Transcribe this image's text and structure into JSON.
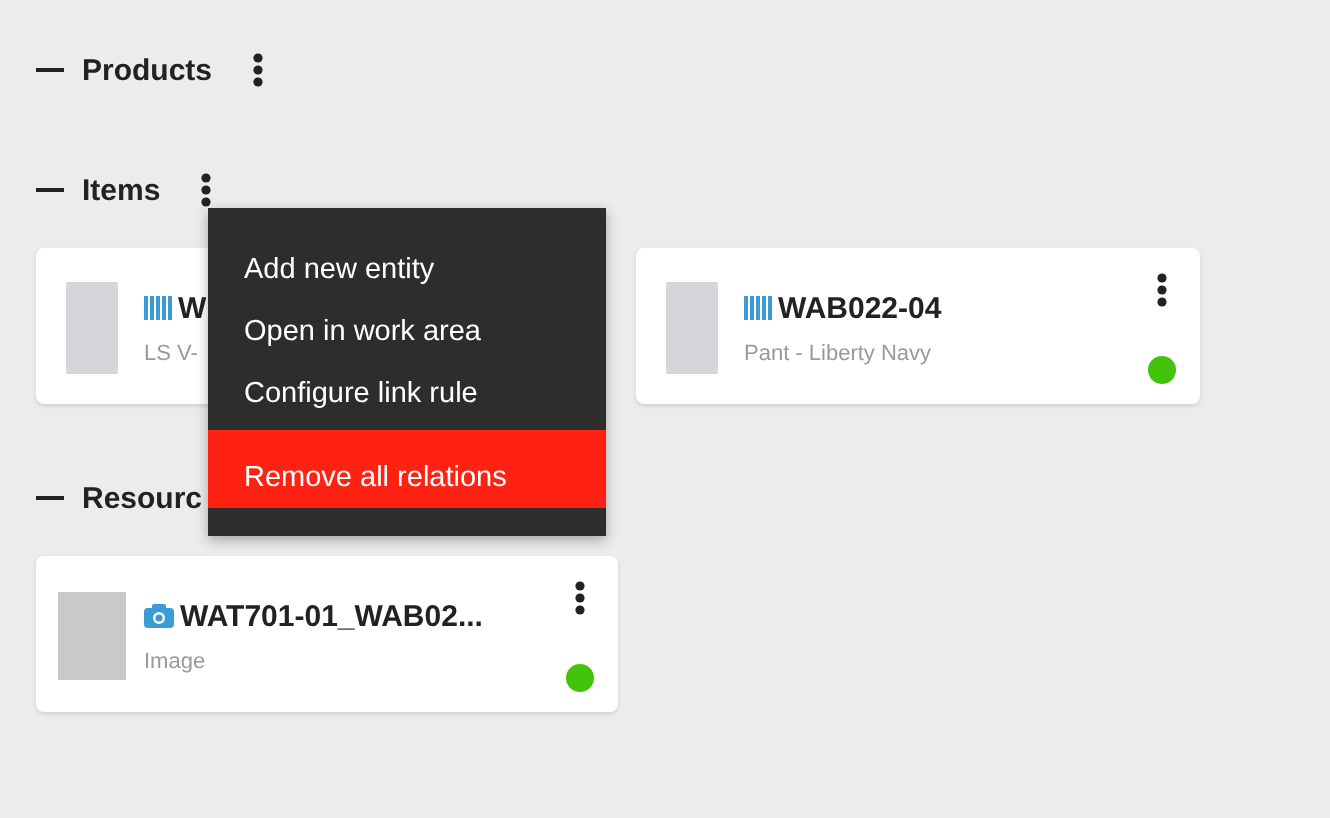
{
  "sections": [
    {
      "title": "Products",
      "expanded": true
    },
    {
      "title": "Items",
      "expanded": true,
      "cards": [
        {
          "kind": "item",
          "title": "W",
          "subtitle": "LS V-"
        },
        {
          "kind": "item",
          "title": "WAB022-04",
          "subtitle": "Pant - Liberty Navy",
          "color": "#44c30c"
        }
      ]
    },
    {
      "title": "Resourc",
      "expanded": true,
      "cards": [
        {
          "kind": "resource",
          "title": "WAT701-01_WAB02...",
          "subtitle": "Image",
          "color": "#44c30c"
        }
      ]
    }
  ],
  "context_menu": {
    "items": [
      {
        "label": "Add new entity",
        "selected": false
      },
      {
        "label": "Open in work area",
        "selected": false
      },
      {
        "label": "Configure link rule",
        "selected": false
      },
      {
        "label": "Remove all relations",
        "selected": true
      }
    ]
  }
}
